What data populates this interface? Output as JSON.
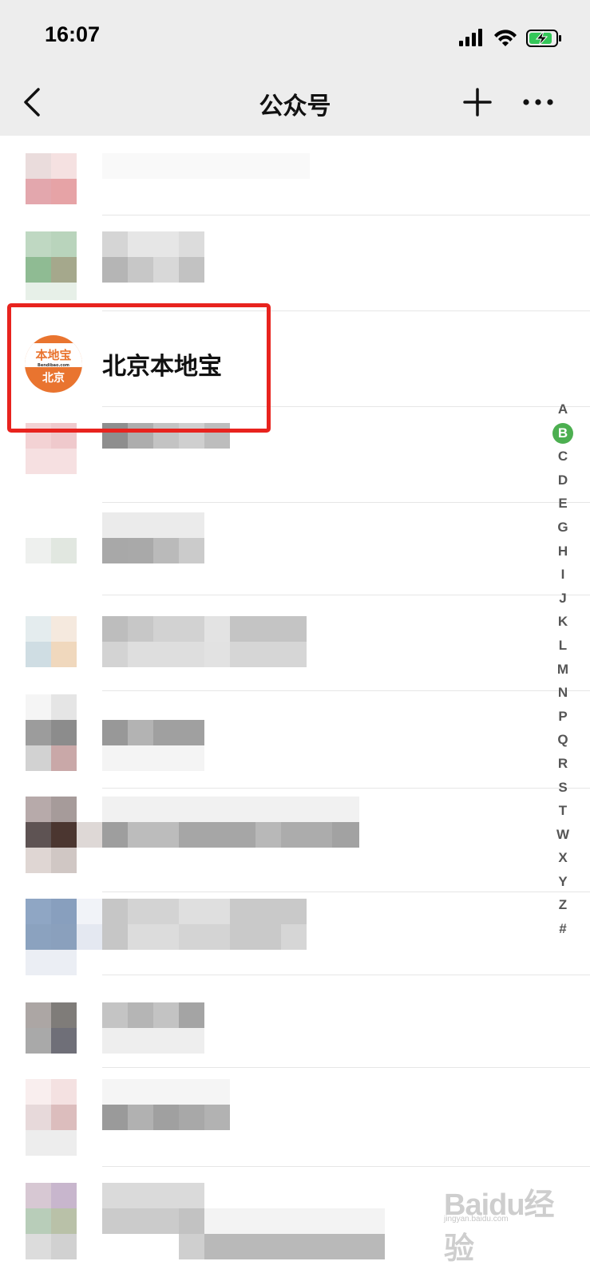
{
  "status_bar": {
    "time": "16:07",
    "icons": [
      "signal-icon",
      "wifi-icon",
      "battery-charging-icon"
    ]
  },
  "nav": {
    "title": "公众号",
    "back_icon": "chevron-left-icon",
    "add_icon": "plus-icon",
    "more_icon": "more-icon"
  },
  "highlighted_account": {
    "name": "北京本地宝",
    "avatar_text_top": "本地宝",
    "avatar_text_url": "Bendibao.com",
    "avatar_text_bottom": "北京",
    "highlight_color": "#e8231e"
  },
  "index_bar": {
    "letters": [
      "A",
      "B",
      "C",
      "D",
      "E",
      "G",
      "H",
      "I",
      "J",
      "K",
      "L",
      "M",
      "N",
      "P",
      "Q",
      "R",
      "S",
      "T",
      "W",
      "X",
      "Y",
      "Z",
      "#"
    ],
    "active_letter": "B",
    "active_color": "#4caf50"
  },
  "watermark": {
    "main": "Baidu经验",
    "sub": "jingyan.baidu.com"
  }
}
